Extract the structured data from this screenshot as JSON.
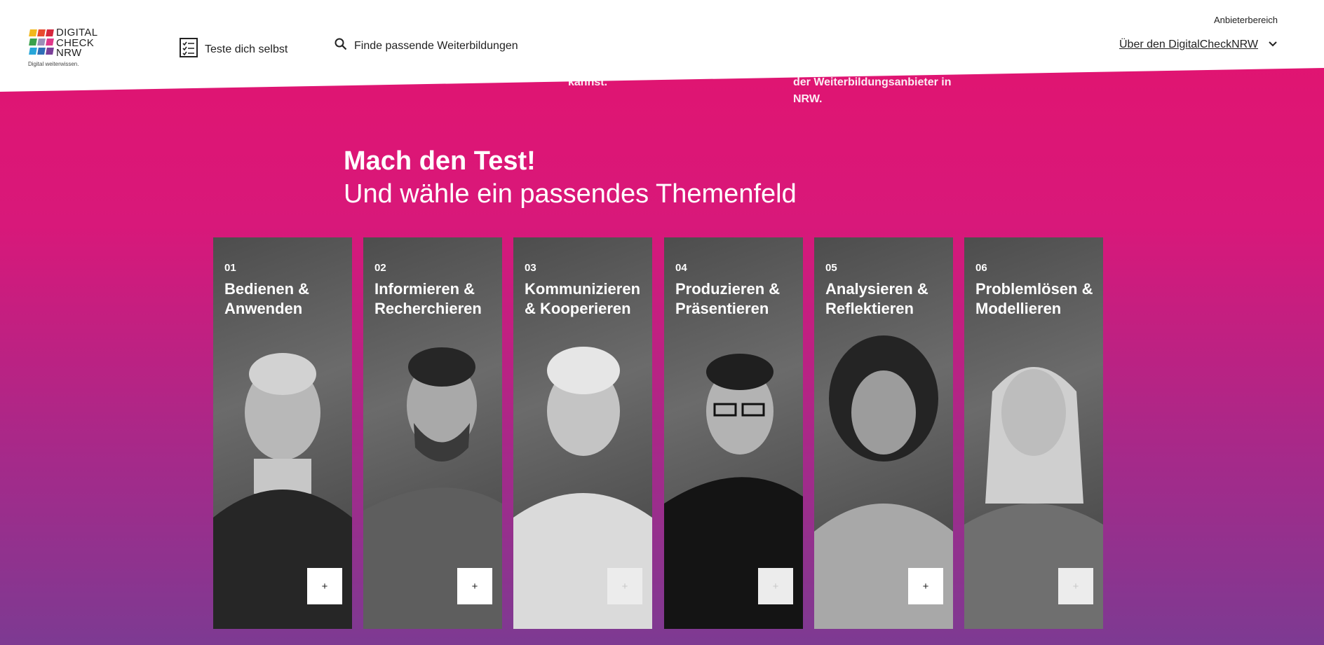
{
  "header": {
    "logo": {
      "words": [
        "DIGITAL",
        "CHECK",
        "NRW"
      ],
      "tagline": "Digital weiterwissen.",
      "colors": [
        "#f1b81c",
        "#e84a2f",
        "#d7263d",
        "#3aa14b",
        "#9b8fb8",
        "#e0388a",
        "#27a6d9",
        "#2f6fb7",
        "#7a3f98"
      ]
    },
    "nav": {
      "test_label": "Teste dich selbst",
      "search_label": "Finde passende Weiterbildungen"
    },
    "provider_label": "Anbieterbereich",
    "about_label": "Über den DigitalCheckNRW"
  },
  "peek": {
    "left_text": "kannst.",
    "right_lines": [
      "der Weiterbildungsanbieter in",
      "NRW."
    ]
  },
  "hero": {
    "title": "Mach den Test!",
    "subtitle": "Und wähle ein passendes Themenfeld"
  },
  "cards": [
    {
      "number": "01",
      "line1": "Bedienen &",
      "line2": "Anwenden",
      "plus": "+",
      "state": "active"
    },
    {
      "number": "02",
      "line1": "Informieren &",
      "line2": "Recherchieren",
      "plus": "+",
      "state": "active"
    },
    {
      "number": "03",
      "line1": "Kommunizieren",
      "line2": "& Kooperieren",
      "plus": "+",
      "state": "dim"
    },
    {
      "number": "04",
      "line1": "Produzieren &",
      "line2": "Präsentieren",
      "plus": "+",
      "state": "dim"
    },
    {
      "number": "05",
      "line1": "Analysieren &",
      "line2": "Reflektieren",
      "plus": "+",
      "state": "active"
    },
    {
      "number": "06",
      "line1": "Problemlösen &",
      "line2": "Modellieren",
      "plus": "+",
      "state": "dim"
    }
  ],
  "colors": {
    "gradient_top": "#e3136e",
    "gradient_bottom": "#7d3a92",
    "card_bg": "#4d4d4d"
  }
}
